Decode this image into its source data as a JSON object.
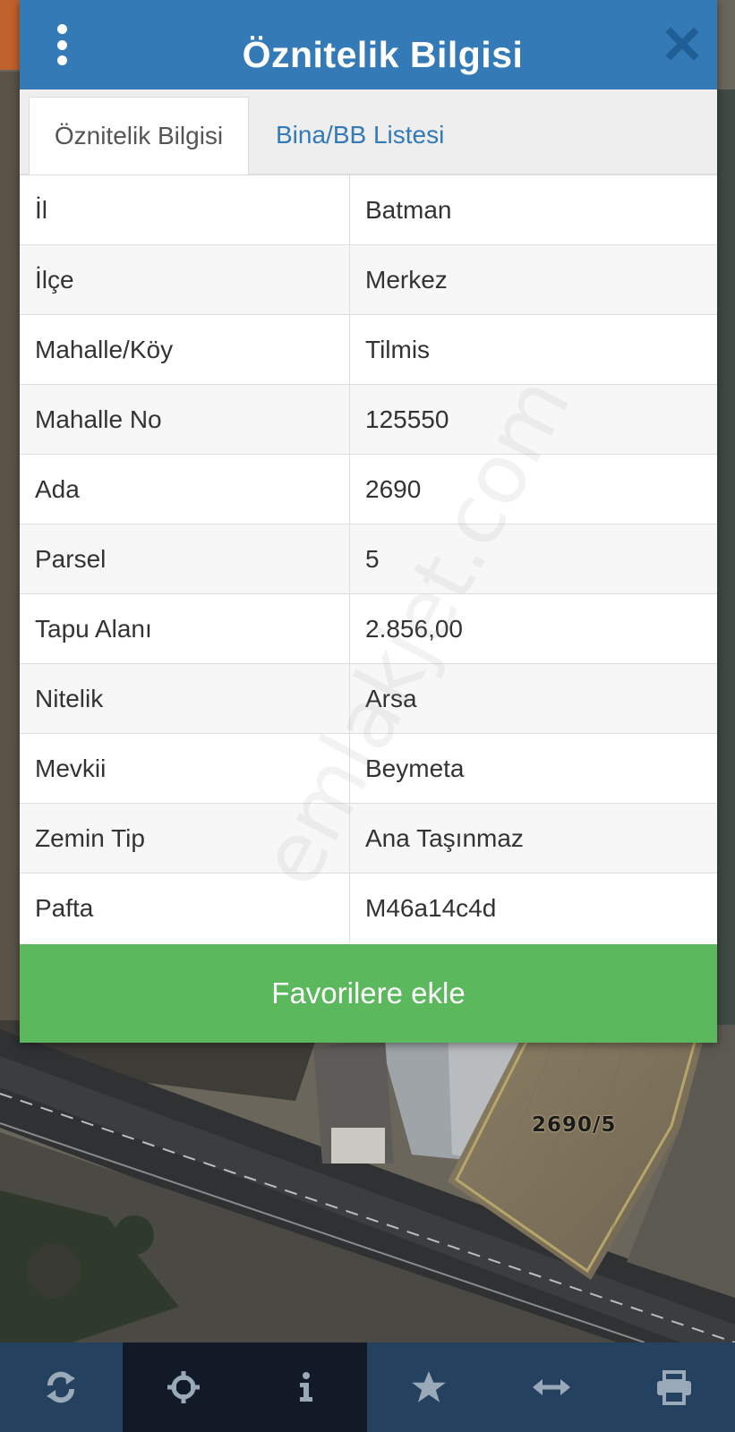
{
  "dialog": {
    "title": "Öznitelik Bilgisi",
    "tabs": [
      {
        "label": "Öznitelik Bilgisi",
        "active": true
      },
      {
        "label": "Bina/BB Listesi",
        "active": false
      }
    ],
    "rows": [
      {
        "key": "İl",
        "value": "Batman"
      },
      {
        "key": "İlçe",
        "value": "Merkez"
      },
      {
        "key": "Mahalle/Köy",
        "value": "Tilmis"
      },
      {
        "key": "Mahalle No",
        "value": "125550"
      },
      {
        "key": "Ada",
        "value": "2690"
      },
      {
        "key": "Parsel",
        "value": "5"
      },
      {
        "key": "Tapu Alanı",
        "value": "2.856,00"
      },
      {
        "key": "Nitelik",
        "value": "Arsa"
      },
      {
        "key": "Mevkii",
        "value": "Beymeta"
      },
      {
        "key": "Zemin Tip",
        "value": "Ana Taşınmaz"
      },
      {
        "key": "Pafta",
        "value": "M46a14c4d"
      }
    ],
    "favorite_button": "Favorilere ekle",
    "menu_icon": "vertical-dots-icon",
    "close_icon": "close-icon"
  },
  "map": {
    "parcel_label": "2690/5",
    "watermark": "emlakjet.com"
  },
  "toolbar": {
    "items": [
      {
        "icon": "refresh-icon",
        "active": false
      },
      {
        "icon": "crosshair-icon",
        "active": true
      },
      {
        "icon": "info-icon",
        "active": true
      },
      {
        "icon": "star-icon",
        "active": false
      },
      {
        "icon": "measure-arrows-icon",
        "active": false
      },
      {
        "icon": "printer-icon",
        "active": false
      }
    ]
  },
  "colors": {
    "header": "#337ab7",
    "favorite_button": "#5cb85c",
    "toolbar": "#24415f",
    "toolbar_active": "#111a26"
  }
}
